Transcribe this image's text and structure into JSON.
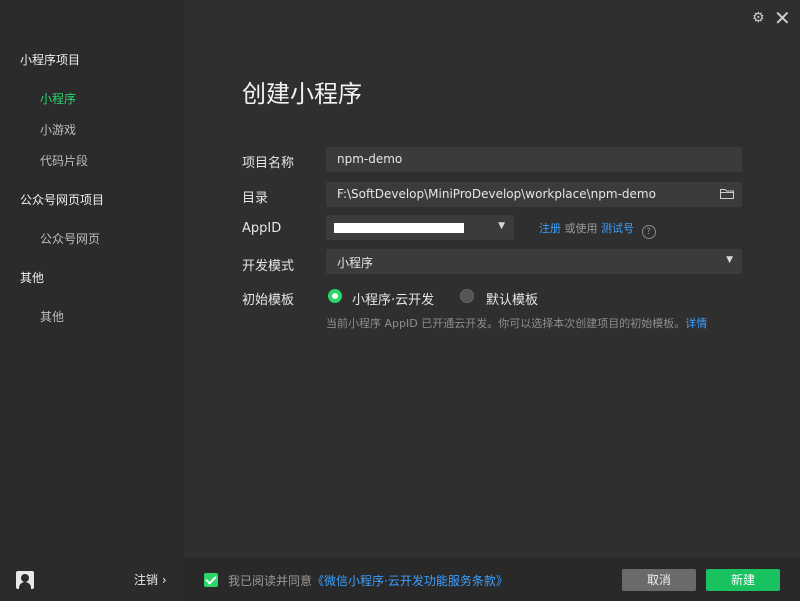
{
  "sidebar": {
    "groups": [
      {
        "title": "小程序项目",
        "items": [
          {
            "label": "小程序",
            "active": true
          },
          {
            "label": "小游戏"
          },
          {
            "label": "代码片段"
          }
        ]
      },
      {
        "title": "公众号网页项目",
        "items": [
          {
            "label": "公众号网页"
          }
        ]
      },
      {
        "title": "其他",
        "items": [
          {
            "label": "其他"
          }
        ]
      }
    ],
    "logout_label": "注销 ›"
  },
  "main": {
    "title": "创建小程序",
    "form": {
      "project_name": {
        "label": "项目名称",
        "value": "npm-demo"
      },
      "directory": {
        "label": "目录",
        "value": "F:\\SoftDevelop\\MiniProDevelop\\workplace\\npm-demo"
      },
      "appid": {
        "label": "AppID",
        "register_link": "注册",
        "or_use": "或使用",
        "test_link": "测试号",
        "help": "?"
      },
      "dev_mode": {
        "label": "开发模式",
        "value": "小程序"
      },
      "template": {
        "label": "初始模板",
        "options": [
          {
            "label": "小程序·云开发",
            "selected": true
          },
          {
            "label": "默认模板",
            "selected": false
          }
        ],
        "hint": "当前小程序 AppID 已开通云开发。你可以选择本次创建项目的初始模板。",
        "hint_link": "详情"
      }
    }
  },
  "footer": {
    "agree_prefix": "我已阅读并同意",
    "agree_link": "《微信小程序·云开发功能服务条款》",
    "cancel_label": "取消",
    "create_label": "新建"
  },
  "colors": {
    "accent": "#2bd66b",
    "link": "#3ea0ff",
    "primary_button": "#19c15f"
  }
}
